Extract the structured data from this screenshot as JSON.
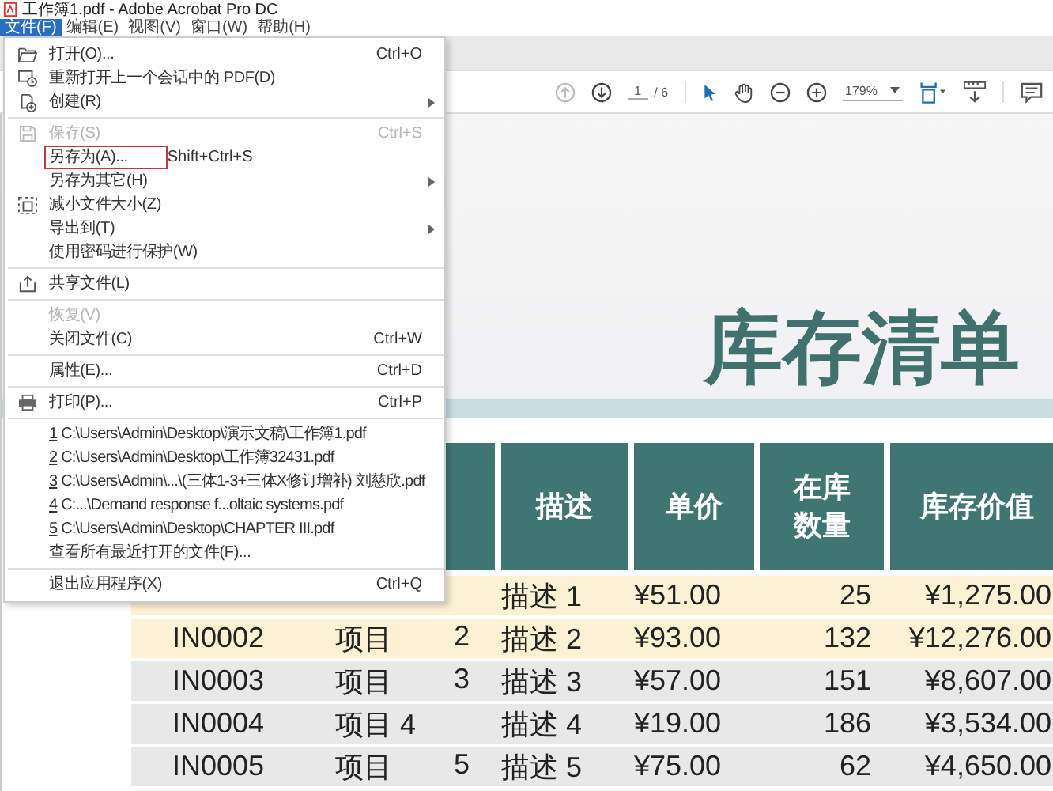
{
  "window": {
    "title": "工作簿1.pdf - Adobe Acrobat Pro DC"
  },
  "menubar": [
    {
      "label": "文件(F)",
      "selected": true
    },
    {
      "label": "编辑(E)",
      "selected": false
    },
    {
      "label": "视图(V)",
      "selected": false
    },
    {
      "label": "窗口(W)",
      "selected": false
    },
    {
      "label": "帮助(H)",
      "selected": false
    }
  ],
  "file_menu": [
    [
      {
        "label": "打开(O)...",
        "shortcut": "Ctrl+O",
        "submenu": false,
        "disabled": false,
        "highlighted": false
      },
      {
        "label": "重新打开上一个会话中的 PDF(D)",
        "submenu": false,
        "disabled": false,
        "highlighted": false
      },
      {
        "label": "创建(R)",
        "submenu": true,
        "disabled": false,
        "highlighted": false
      }
    ],
    [
      {
        "label": "保存(S)",
        "shortcut": "Ctrl+S",
        "submenu": false,
        "disabled": true,
        "highlighted": false
      },
      {
        "label": "另存为(A)...",
        "shortcut": "Shift+Ctrl+S",
        "submenu": false,
        "disabled": false,
        "highlighted": true
      },
      {
        "label": "另存为其它(H)",
        "submenu": true,
        "disabled": false,
        "highlighted": false
      },
      {
        "label": "减小文件大小(Z)",
        "submenu": false,
        "disabled": false,
        "highlighted": false
      },
      {
        "label": "导出到(T)",
        "submenu": true,
        "disabled": false,
        "highlighted": false
      },
      {
        "label": "使用密码进行保护(W)",
        "submenu": false,
        "disabled": false,
        "highlighted": false
      }
    ],
    [
      {
        "label": "共享文件(L)",
        "submenu": false,
        "disabled": false,
        "highlighted": false
      }
    ],
    [
      {
        "label": "恢复(V)",
        "submenu": false,
        "disabled": true,
        "highlighted": false
      },
      {
        "label": "关闭文件(C)",
        "shortcut": "Ctrl+W",
        "submenu": false,
        "disabled": false,
        "highlighted": false
      }
    ],
    [
      {
        "label": "属性(E)...",
        "shortcut": "Ctrl+D",
        "submenu": false,
        "disabled": false,
        "highlighted": false
      }
    ],
    [
      {
        "label": "打印(P)...",
        "shortcut": "Ctrl+P",
        "submenu": false,
        "disabled": false,
        "highlighted": false
      }
    ],
    [
      {
        "number": "1",
        "label": "C:\\Users\\Admin\\Desktop\\演示文稿\\工作簿1.pdf",
        "submenu": false,
        "disabled": false,
        "highlighted": false
      },
      {
        "number": "2",
        "label": "C:\\Users\\Admin\\Desktop\\工作簿32431.pdf",
        "submenu": false,
        "disabled": false,
        "highlighted": false
      },
      {
        "number": "3",
        "label": "C:\\Users\\Admin\\...\\(三体1-3+三体X修订增补) 刘慈欣.pdf",
        "submenu": false,
        "disabled": false,
        "highlighted": false
      },
      {
        "number": "4",
        "label": "C:...\\Demand response f...oltaic systems.pdf",
        "submenu": false,
        "disabled": false,
        "highlighted": false
      },
      {
        "number": "5",
        "label": "C:\\Users\\Admin\\Desktop\\CHAPTER III.pdf",
        "submenu": false,
        "disabled": false,
        "highlighted": false
      },
      {
        "label": "查看所有最近打开的文件(F)...",
        "submenu": false,
        "disabled": false,
        "highlighted": false
      }
    ],
    [
      {
        "label": "退出应用程序(X)",
        "shortcut": "Ctrl+Q",
        "submenu": false,
        "disabled": false,
        "highlighted": false
      }
    ]
  ],
  "toolbar": {
    "nav": [
      {
        "disabled": true
      },
      {
        "disabled": false
      }
    ],
    "page": "1",
    "page_count": "/ 6",
    "zoom": "179%"
  },
  "document": {
    "title": "库存清单",
    "columns": [
      "描述",
      "单价",
      "在库数量",
      "库存价值"
    ],
    "rows": [
      {
        "description": "描述 1",
        "price": "¥51.00",
        "quantity": "25",
        "value": "¥1,275.00",
        "highlighted": true
      },
      {
        "id": "IN0002",
        "item": "项目",
        "item_no": "2",
        "description": "描述 2",
        "price": "¥93.00",
        "quantity": "132",
        "value": "¥12,276.00",
        "highlighted": true
      },
      {
        "id": "IN0003",
        "item": "项目",
        "item_no": "3",
        "description": "描述 3",
        "price": "¥57.00",
        "quantity": "151",
        "value": "¥8,607.00",
        "highlighted": false
      },
      {
        "id": "IN0004",
        "item": "项目 4",
        "description": "描述 4",
        "price": "¥19.00",
        "quantity": "186",
        "value": "¥3,534.00",
        "highlighted": false
      },
      {
        "id": "IN0005",
        "item": "项目",
        "item_no": "5",
        "description": "描述 5",
        "price": "¥75.00",
        "quantity": "62",
        "value": "¥4,650.00",
        "highlighted": false
      }
    ]
  }
}
